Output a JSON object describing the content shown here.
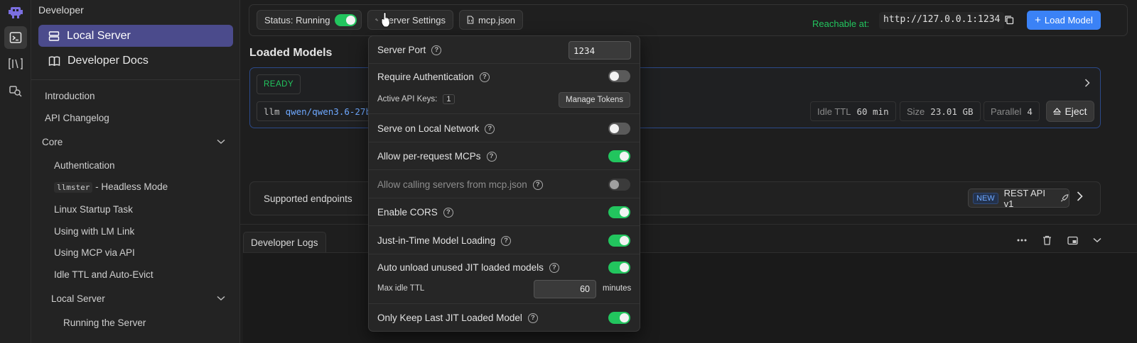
{
  "sidebar": {
    "title": "Developer",
    "main_items": [
      {
        "label": "Local Server",
        "icon": "server-icon"
      },
      {
        "label": "Developer Docs",
        "icon": "book-icon"
      }
    ],
    "links": {
      "introduction": "Introduction",
      "api_changelog": "API Changelog",
      "core": "Core",
      "authentication": "Authentication",
      "llmster_code": "llmster",
      "llmster_rest": " - Headless Mode",
      "linux_startup": "Linux Startup Task",
      "lm_link": "Using with LM Link",
      "mcp_api": "Using MCP via API",
      "idle_ttl": "Idle TTL and Auto-Evict",
      "local_server": "Local Server",
      "running_server": "Running the Server"
    }
  },
  "topbar": {
    "status_label": "Status: Running",
    "status_on": true,
    "server_settings": "Server Settings",
    "mcp_json": "mcp.json",
    "reachable_label": "Reachable at:",
    "reachable_url": "http://127.0.0.1:1234",
    "load_model": "Load Model",
    "accent_color": "#3b82f6"
  },
  "loaded_models": {
    "title": "Loaded Models",
    "badge": "READY",
    "model_type": "llm",
    "model_name": "qwen/qwen3.6-27b",
    "idle_ttl_label": "Idle TTL",
    "idle_ttl_value": "60 min",
    "size_label": "Size",
    "size_value": "23.01 GB",
    "parallel_label": "Parallel",
    "parallel_value": "4",
    "eject": "Eject"
  },
  "endpoints": {
    "label": "Supported endpoints",
    "new_tag": "NEW",
    "rest_api": "REST API v1"
  },
  "logs": {
    "tab": "Developer Logs"
  },
  "settings": {
    "server_port_label": "Server Port",
    "server_port_value": "1234",
    "require_auth_label": "Require Authentication",
    "active_keys_label": "Active API Keys:",
    "active_keys_count": "1",
    "manage_tokens": "Manage Tokens",
    "local_network_label": "Serve on Local Network",
    "per_request_mcp_label": "Allow per-request MCPs",
    "calling_servers_label": "Allow calling servers from mcp.json",
    "cors_label": "Enable CORS",
    "jit_label": "Just-in-Time Model Loading",
    "auto_unload_label": "Auto unload unused JIT loaded models",
    "max_idle_ttl_label": "Max idle TTL",
    "max_idle_ttl_value": "60",
    "max_idle_ttl_unit": "minutes",
    "only_keep_last_label": "Only Keep Last JIT Loaded Model",
    "toggles": {
      "require_auth": false,
      "local_network": false,
      "per_request_mcp": true,
      "calling_servers": false,
      "cors": true,
      "jit": true,
      "auto_unload": true,
      "only_keep_last": true
    },
    "on_color": "#22c55e"
  }
}
